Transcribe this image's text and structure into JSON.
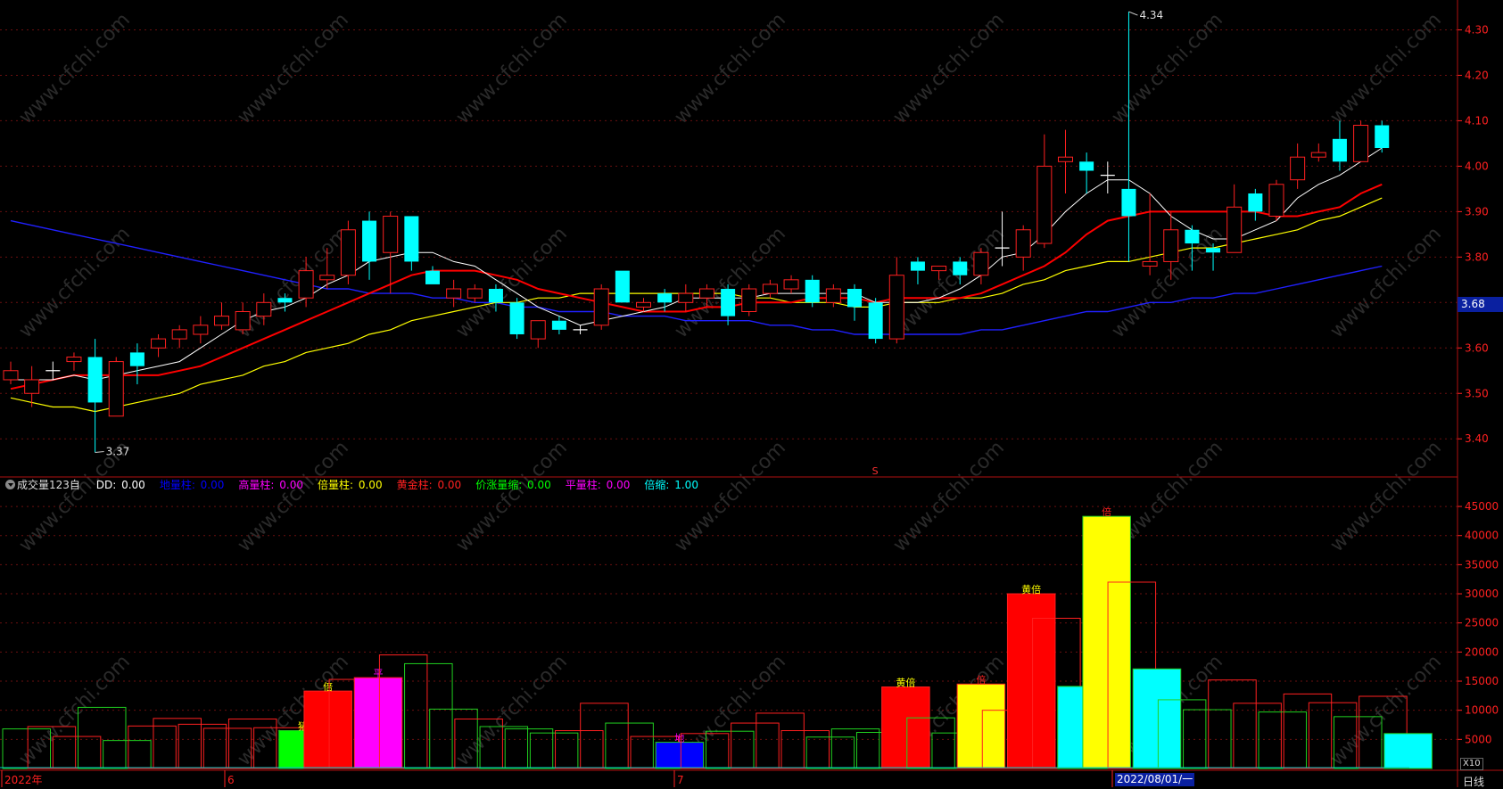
{
  "colors": {
    "up": "#ff2020",
    "down": "#00ffff",
    "ma5": "#ffffff",
    "ma10": "#ff0000",
    "ma20": "#ffff00",
    "ma60": "#2020ff",
    "axis": "#ff2020"
  },
  "chart_data": [
    {
      "type": "candlestick",
      "title": "",
      "y_ticks": [
        "4.30",
        "4.20",
        "4.10",
        "4.00",
        "3.90",
        "3.80",
        "3.70",
        "3.60",
        "3.50",
        "3.40"
      ],
      "ylim": [
        3.32,
        4.35
      ],
      "high_annotation": "4.34",
      "low_annotation": "3.37",
      "current_price": "3.68",
      "marker": "S",
      "candles": [
        {
          "o": 3.53,
          "c": 3.55,
          "h": 3.57,
          "l": 3.52
        },
        {
          "o": 3.5,
          "c": 3.53,
          "h": 3.56,
          "l": 3.47
        },
        {
          "o": 3.55,
          "c": 3.55,
          "h": 3.57,
          "l": 3.53
        },
        {
          "o": 3.57,
          "c": 3.58,
          "h": 3.59,
          "l": 3.55
        },
        {
          "o": 3.58,
          "c": 3.48,
          "h": 3.62,
          "l": 3.37
        },
        {
          "o": 3.45,
          "c": 3.57,
          "h": 3.58,
          "l": 3.45
        },
        {
          "o": 3.59,
          "c": 3.56,
          "h": 3.61,
          "l": 3.52
        },
        {
          "o": 3.6,
          "c": 3.62,
          "h": 3.63,
          "l": 3.58
        },
        {
          "o": 3.62,
          "c": 3.64,
          "h": 3.65,
          "l": 3.6
        },
        {
          "o": 3.63,
          "c": 3.65,
          "h": 3.67,
          "l": 3.61
        },
        {
          "o": 3.65,
          "c": 3.67,
          "h": 3.7,
          "l": 3.64
        },
        {
          "o": 3.64,
          "c": 3.68,
          "h": 3.7,
          "l": 3.63
        },
        {
          "o": 3.67,
          "c": 3.7,
          "h": 3.72,
          "l": 3.65
        },
        {
          "o": 3.71,
          "c": 3.7,
          "h": 3.72,
          "l": 3.68
        },
        {
          "o": 3.71,
          "c": 3.77,
          "h": 3.8,
          "l": 3.69
        },
        {
          "o": 3.75,
          "c": 3.76,
          "h": 3.82,
          "l": 3.73
        },
        {
          "o": 3.76,
          "c": 3.86,
          "h": 3.88,
          "l": 3.74
        },
        {
          "o": 3.88,
          "c": 3.79,
          "h": 3.9,
          "l": 3.75
        },
        {
          "o": 3.81,
          "c": 3.89,
          "h": 3.9,
          "l": 3.72
        },
        {
          "o": 3.89,
          "c": 3.79,
          "h": 3.89,
          "l": 3.77
        },
        {
          "o": 3.77,
          "c": 3.74,
          "h": 3.78,
          "l": 3.74
        },
        {
          "o": 3.71,
          "c": 3.73,
          "h": 3.75,
          "l": 3.69
        },
        {
          "o": 3.71,
          "c": 3.73,
          "h": 3.74,
          "l": 3.7
        },
        {
          "o": 3.73,
          "c": 3.7,
          "h": 3.74,
          "l": 3.68
        },
        {
          "o": 3.7,
          "c": 3.63,
          "h": 3.71,
          "l": 3.62
        },
        {
          "o": 3.62,
          "c": 3.66,
          "h": 3.66,
          "l": 3.6
        },
        {
          "o": 3.66,
          "c": 3.64,
          "h": 3.67,
          "l": 3.63
        },
        {
          "o": 3.64,
          "c": 3.64,
          "h": 3.65,
          "l": 3.63
        },
        {
          "o": 3.65,
          "c": 3.73,
          "h": 3.74,
          "l": 3.64
        },
        {
          "o": 3.77,
          "c": 3.7,
          "h": 3.77,
          "l": 3.7
        },
        {
          "o": 3.69,
          "c": 3.7,
          "h": 3.71,
          "l": 3.68
        },
        {
          "o": 3.72,
          "c": 3.7,
          "h": 3.73,
          "l": 3.68
        },
        {
          "o": 3.7,
          "c": 3.72,
          "h": 3.74,
          "l": 3.68
        },
        {
          "o": 3.71,
          "c": 3.73,
          "h": 3.74,
          "l": 3.69
        },
        {
          "o": 3.73,
          "c": 3.67,
          "h": 3.74,
          "l": 3.65
        },
        {
          "o": 3.68,
          "c": 3.73,
          "h": 3.74,
          "l": 3.67
        },
        {
          "o": 3.72,
          "c": 3.74,
          "h": 3.75,
          "l": 3.71
        },
        {
          "o": 3.73,
          "c": 3.75,
          "h": 3.76,
          "l": 3.72
        },
        {
          "o": 3.75,
          "c": 3.7,
          "h": 3.76,
          "l": 3.69
        },
        {
          "o": 3.7,
          "c": 3.73,
          "h": 3.74,
          "l": 3.69
        },
        {
          "o": 3.73,
          "c": 3.69,
          "h": 3.74,
          "l": 3.66
        },
        {
          "o": 3.7,
          "c": 3.62,
          "h": 3.71,
          "l": 3.61
        },
        {
          "o": 3.62,
          "c": 3.76,
          "h": 3.8,
          "l": 3.61
        },
        {
          "o": 3.79,
          "c": 3.77,
          "h": 3.8,
          "l": 3.74
        },
        {
          "o": 3.77,
          "c": 3.78,
          "h": 3.78,
          "l": 3.75
        },
        {
          "o": 3.79,
          "c": 3.76,
          "h": 3.8,
          "l": 3.74
        },
        {
          "o": 3.76,
          "c": 3.81,
          "h": 3.82,
          "l": 3.74
        },
        {
          "o": 3.82,
          "c": 3.82,
          "h": 3.9,
          "l": 3.78
        },
        {
          "o": 3.8,
          "c": 3.86,
          "h": 3.87,
          "l": 3.77
        },
        {
          "o": 3.83,
          "c": 4.0,
          "h": 4.07,
          "l": 3.82
        },
        {
          "o": 4.01,
          "c": 4.02,
          "h": 4.08,
          "l": 3.94
        },
        {
          "o": 4.01,
          "c": 3.99,
          "h": 4.03,
          "l": 3.94
        },
        {
          "o": 3.98,
          "c": 3.98,
          "h": 4.01,
          "l": 3.94
        },
        {
          "o": 3.95,
          "c": 3.89,
          "h": 4.34,
          "l": 3.79
        },
        {
          "o": 3.78,
          "c": 3.79,
          "h": 3.94,
          "l": 3.76
        },
        {
          "o": 3.79,
          "c": 3.86,
          "h": 3.9,
          "l": 3.75
        },
        {
          "o": 3.86,
          "c": 3.83,
          "h": 3.87,
          "l": 3.77
        },
        {
          "o": 3.82,
          "c": 3.81,
          "h": 3.83,
          "l": 3.77
        },
        {
          "o": 3.81,
          "c": 3.91,
          "h": 3.96,
          "l": 3.81
        },
        {
          "o": 3.94,
          "c": 3.9,
          "h": 3.95,
          "l": 3.88
        },
        {
          "o": 3.89,
          "c": 3.96,
          "h": 3.97,
          "l": 3.88
        },
        {
          "o": 3.97,
          "c": 4.02,
          "h": 4.05,
          "l": 3.95
        },
        {
          "o": 4.02,
          "c": 4.03,
          "h": 4.05,
          "l": 4.01
        },
        {
          "o": 4.06,
          "c": 4.01,
          "h": 4.1,
          "l": 3.99
        },
        {
          "o": 4.01,
          "c": 4.09,
          "h": 4.1,
          "l": 4.01
        },
        {
          "o": 4.09,
          "c": 4.04,
          "h": 4.1,
          "l": 4.03
        }
      ],
      "ma5": [
        3.53,
        3.53,
        3.53,
        3.54,
        3.53,
        3.54,
        3.55,
        3.56,
        3.57,
        3.6,
        3.63,
        3.66,
        3.68,
        3.69,
        3.71,
        3.74,
        3.76,
        3.79,
        3.8,
        3.81,
        3.81,
        3.79,
        3.78,
        3.75,
        3.72,
        3.69,
        3.67,
        3.65,
        3.66,
        3.67,
        3.68,
        3.69,
        3.71,
        3.71,
        3.71,
        3.71,
        3.72,
        3.72,
        3.72,
        3.72,
        3.72,
        3.7,
        3.7,
        3.7,
        3.71,
        3.73,
        3.76,
        3.8,
        3.81,
        3.85,
        3.9,
        3.94,
        3.97,
        3.97,
        3.94,
        3.89,
        3.86,
        3.84,
        3.84,
        3.86,
        3.88,
        3.93,
        3.96,
        3.98,
        4.01,
        4.04
      ],
      "ma10": [
        3.51,
        3.52,
        3.53,
        3.54,
        3.54,
        3.54,
        3.54,
        3.54,
        3.55,
        3.56,
        3.58,
        3.6,
        3.62,
        3.64,
        3.66,
        3.68,
        3.7,
        3.72,
        3.74,
        3.76,
        3.77,
        3.77,
        3.77,
        3.76,
        3.75,
        3.73,
        3.72,
        3.71,
        3.7,
        3.69,
        3.68,
        3.68,
        3.68,
        3.69,
        3.69,
        3.7,
        3.7,
        3.7,
        3.71,
        3.71,
        3.71,
        3.7,
        3.71,
        3.71,
        3.71,
        3.71,
        3.72,
        3.74,
        3.76,
        3.78,
        3.81,
        3.85,
        3.88,
        3.89,
        3.9,
        3.9,
        3.9,
        3.9,
        3.9,
        3.9,
        3.89,
        3.89,
        3.9,
        3.91,
        3.94,
        3.96
      ],
      "ma20": [
        3.49,
        3.48,
        3.47,
        3.47,
        3.46,
        3.47,
        3.48,
        3.49,
        3.5,
        3.52,
        3.53,
        3.54,
        3.56,
        3.57,
        3.59,
        3.6,
        3.61,
        3.63,
        3.64,
        3.66,
        3.67,
        3.68,
        3.69,
        3.7,
        3.7,
        3.71,
        3.71,
        3.72,
        3.72,
        3.72,
        3.72,
        3.72,
        3.72,
        3.72,
        3.72,
        3.71,
        3.71,
        3.7,
        3.7,
        3.7,
        3.69,
        3.69,
        3.7,
        3.7,
        3.7,
        3.71,
        3.71,
        3.72,
        3.74,
        3.75,
        3.77,
        3.78,
        3.79,
        3.79,
        3.8,
        3.81,
        3.82,
        3.82,
        3.83,
        3.84,
        3.85,
        3.86,
        3.88,
        3.89,
        3.91,
        3.93
      ],
      "ma60": [
        3.88,
        3.87,
        3.86,
        3.85,
        3.84,
        3.83,
        3.82,
        3.81,
        3.8,
        3.79,
        3.78,
        3.77,
        3.76,
        3.75,
        3.74,
        3.73,
        3.73,
        3.72,
        3.72,
        3.72,
        3.71,
        3.71,
        3.7,
        3.7,
        3.69,
        3.69,
        3.68,
        3.68,
        3.68,
        3.67,
        3.67,
        3.67,
        3.66,
        3.66,
        3.66,
        3.66,
        3.65,
        3.65,
        3.64,
        3.64,
        3.63,
        3.63,
        3.63,
        3.63,
        3.63,
        3.63,
        3.64,
        3.64,
        3.65,
        3.66,
        3.67,
        3.68,
        3.68,
        3.69,
        3.7,
        3.7,
        3.71,
        3.71,
        3.72,
        3.72,
        3.73,
        3.74,
        3.75,
        3.76,
        3.77,
        3.78
      ]
    },
    {
      "type": "bar",
      "title": "成交量123自",
      "y_ticks": [
        "45000",
        "40000",
        "35000",
        "30000",
        "25000",
        "20000",
        "15000",
        "10000",
        "5000"
      ],
      "ylim": [
        0,
        47000
      ],
      "scale_label": "X10",
      "bars": [
        {
          "v": 6800,
          "dir": "down",
          "fill": ""
        },
        {
          "v": 7200,
          "dir": "up",
          "fill": ""
        },
        {
          "v": 5500,
          "dir": "up",
          "fill": ""
        },
        {
          "v": 10500,
          "dir": "down",
          "fill": ""
        },
        {
          "v": 4800,
          "dir": "down",
          "fill": ""
        },
        {
          "v": 7300,
          "dir": "up",
          "fill": ""
        },
        {
          "v": 8600,
          "dir": "up",
          "fill": ""
        },
        {
          "v": 7600,
          "dir": "up",
          "fill": ""
        },
        {
          "v": 6900,
          "dir": "up",
          "fill": ""
        },
        {
          "v": 8500,
          "dir": "up",
          "fill": ""
        },
        {
          "v": 7000,
          "dir": "up",
          "fill": ""
        },
        {
          "v": 6500,
          "dir": "down",
          "fill": "#00ff00",
          "label": "猪"
        },
        {
          "v": 13300,
          "dir": "up",
          "fill": "#ff0000",
          "label": "倍"
        },
        {
          "v": 15300,
          "dir": "up",
          "fill": ""
        },
        {
          "v": 15600,
          "dir": "up",
          "fill": "#ff00ff",
          "label": "平"
        },
        {
          "v": 19500,
          "dir": "up",
          "fill": ""
        },
        {
          "v": 18000,
          "dir": "down",
          "fill": ""
        },
        {
          "v": 10200,
          "dir": "down",
          "fill": ""
        },
        {
          "v": 8500,
          "dir": "up",
          "fill": ""
        },
        {
          "v": 7200,
          "dir": "down",
          "fill": ""
        },
        {
          "v": 6800,
          "dir": "down",
          "fill": ""
        },
        {
          "v": 6100,
          "dir": "down",
          "fill": ""
        },
        {
          "v": 6500,
          "dir": "up",
          "fill": ""
        },
        {
          "v": 11200,
          "dir": "up",
          "fill": ""
        },
        {
          "v": 7800,
          "dir": "down",
          "fill": ""
        },
        {
          "v": 5500,
          "dir": "up",
          "fill": ""
        },
        {
          "v": 4500,
          "dir": "down",
          "fill": "#0000ff",
          "label": "地"
        },
        {
          "v": 6000,
          "dir": "up",
          "fill": ""
        },
        {
          "v": 6400,
          "dir": "down",
          "fill": ""
        },
        {
          "v": 7800,
          "dir": "up",
          "fill": ""
        },
        {
          "v": 9500,
          "dir": "up",
          "fill": ""
        },
        {
          "v": 6500,
          "dir": "up",
          "fill": ""
        },
        {
          "v": 5400,
          "dir": "down",
          "fill": ""
        },
        {
          "v": 6800,
          "dir": "down",
          "fill": ""
        },
        {
          "v": 6200,
          "dir": "down",
          "fill": ""
        },
        {
          "v": 14000,
          "dir": "up",
          "fill": "#ff0000",
          "label": "黄倍"
        },
        {
          "v": 8700,
          "dir": "down",
          "fill": ""
        },
        {
          "v": 6100,
          "dir": "down",
          "fill": ""
        },
        {
          "v": 14500,
          "dir": "up",
          "fill": "#ffff00",
          "label": "倍"
        },
        {
          "v": 10000,
          "dir": "up",
          "fill": ""
        },
        {
          "v": 30000,
          "dir": "up",
          "fill": "#ff0000",
          "label": "黄倍"
        },
        {
          "v": 25800,
          "dir": "up",
          "fill": ""
        },
        {
          "v": 14100,
          "dir": "down",
          "fill": "#00ffff"
        },
        {
          "v": 43300,
          "dir": "down",
          "fill": "#ffff00",
          "label": "倍"
        },
        {
          "v": 32000,
          "dir": "up",
          "fill": ""
        },
        {
          "v": 17100,
          "dir": "down",
          "fill": "#00ffff"
        },
        {
          "v": 11800,
          "dir": "down",
          "fill": ""
        },
        {
          "v": 10100,
          "dir": "down",
          "fill": ""
        },
        {
          "v": 15200,
          "dir": "up",
          "fill": ""
        },
        {
          "v": 11200,
          "dir": "up",
          "fill": ""
        },
        {
          "v": 9700,
          "dir": "down",
          "fill": ""
        },
        {
          "v": 12800,
          "dir": "up",
          "fill": ""
        },
        {
          "v": 11300,
          "dir": "up",
          "fill": ""
        },
        {
          "v": 8900,
          "dir": "down",
          "fill": ""
        },
        {
          "v": 12400,
          "dir": "up",
          "fill": ""
        },
        {
          "v": 6000,
          "dir": "down",
          "fill": "#00ffff"
        }
      ]
    }
  ],
  "legend": {
    "indicator": "成交量123自",
    "items": [
      {
        "name": "DD:",
        "value": "0.00",
        "color": "#ffffff"
      },
      {
        "name": "地量柱:",
        "value": "0.00",
        "color": "#0000ff"
      },
      {
        "name": "高量柱:",
        "value": "0.00",
        "color": "#ff00ff"
      },
      {
        "name": "倍量柱:",
        "value": "0.00",
        "color": "#ffff00"
      },
      {
        "name": "黄金柱:",
        "value": "0.00",
        "color": "#ff2020"
      },
      {
        "name": "价涨量缩:",
        "value": "0.00",
        "color": "#00ff00"
      },
      {
        "name": "平量柱:",
        "value": "0.00",
        "color": "#ff00ff"
      },
      {
        "name": "倍缩:",
        "value": "1.00",
        "color": "#00ffff"
      }
    ]
  },
  "x_axis": {
    "labels": [
      "2022年",
      "6",
      "7",
      "8"
    ],
    "current_date": "2022/08/01/一"
  },
  "period": "日线",
  "watermark": "www.cfchi.com"
}
